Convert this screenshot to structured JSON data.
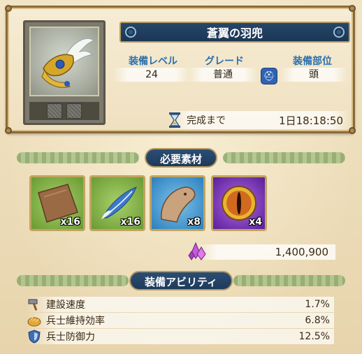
{
  "item": {
    "name": "蒼翼の羽兜",
    "level_label": "装備レベル",
    "level_value": "24",
    "grade_label": "グレード",
    "grade_value": "普通",
    "slot_label": "装備部位",
    "slot_value": "頭",
    "timer_label": "完成まで",
    "timer_value": "1日18:18:50"
  },
  "materials_header": "必要素材",
  "materials": [
    {
      "name": "leather",
      "qty": "x16",
      "color": "#8fb64f"
    },
    {
      "name": "feather",
      "qty": "x16",
      "color": "#8fb64f"
    },
    {
      "name": "beak",
      "qty": "x8",
      "color": "#3b8fc9"
    },
    {
      "name": "dragon-eye",
      "qty": "x4",
      "color": "#7a3bb8"
    }
  ],
  "cost": {
    "icon": "crystal-icon",
    "value": "1,400,900"
  },
  "abilities_header": "装備アビリティ",
  "abilities": [
    {
      "icon": "hammer-icon",
      "name": "建設速度",
      "value": "1.7%"
    },
    {
      "icon": "bread-icon",
      "name": "兵士維持効率",
      "value": "6.8%"
    },
    {
      "icon": "shield-icon",
      "name": "兵士防御力",
      "value": "12.5%"
    }
  ]
}
